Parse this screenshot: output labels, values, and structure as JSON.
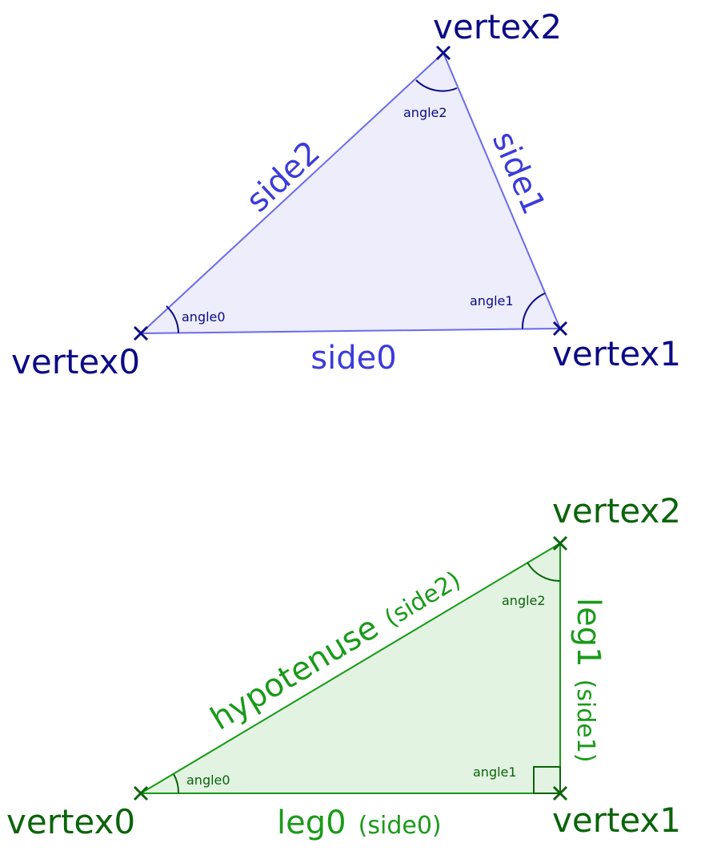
{
  "general": {
    "vertex0": "vertex0",
    "vertex1": "vertex1",
    "vertex2": "vertex2",
    "side0": "side0",
    "side1": "side1",
    "side2": "side2",
    "angle0": "angle0",
    "angle1": "angle1",
    "angle2": "angle2"
  },
  "right": {
    "vertex0": "vertex0",
    "vertex1": "vertex1",
    "vertex2": "vertex2",
    "hypotenuse": "hypotenuse",
    "hypotenuse_alias": "(side2)",
    "leg0": "leg0",
    "leg0_alias": "(side0)",
    "leg1": "leg1",
    "leg1_alias": "(side1)",
    "angle0": "angle0",
    "angle1": "angle1",
    "angle2": "angle2"
  },
  "colors": {
    "general_stroke": "#6b6bea",
    "general_fill": "#ededfb",
    "general_side_text": "#3b3bdc",
    "general_vertex_text": "#0b0b86",
    "right_stroke": "#179a17",
    "right_fill": "#e2f3e2",
    "right_side_text": "#1a9a1a",
    "right_vertex_text": "#0b640b"
  }
}
